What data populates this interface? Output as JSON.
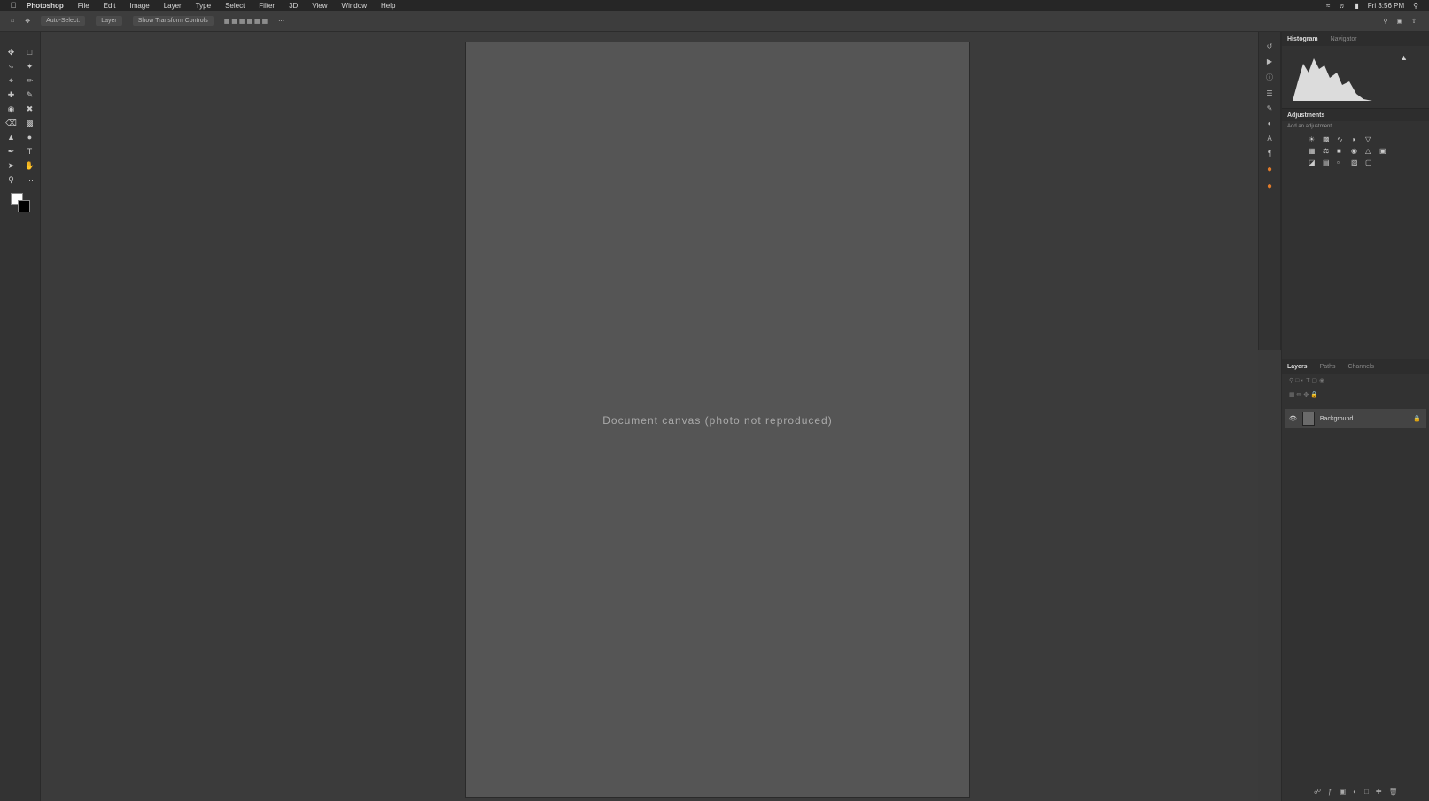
{
  "menubar": {
    "app_name": "Photoshop",
    "items": [
      "File",
      "Edit",
      "Image",
      "Layer",
      "Type",
      "Select",
      "Filter",
      "3D",
      "View",
      "Window",
      "Help"
    ],
    "clock": "Fri 3:56 PM"
  },
  "options_bar": {
    "auto_select": "Auto-Select:",
    "layer_select": "Layer",
    "transform_controls": "Show Transform Controls"
  },
  "document": {
    "placeholder_label": "Document canvas (photo not reproduced)"
  },
  "panels": {
    "histogram_tab": "Histogram",
    "navigator_tab": "Navigator",
    "adjustments_title": "Adjustments",
    "adjustments_add": "Add an adjustment",
    "layers_tab": "Layers",
    "paths_tab": "Paths",
    "channels_tab": "Channels",
    "layer_name": "Background"
  },
  "colors": {
    "foreground": "#ffffff",
    "background": "#000000"
  }
}
